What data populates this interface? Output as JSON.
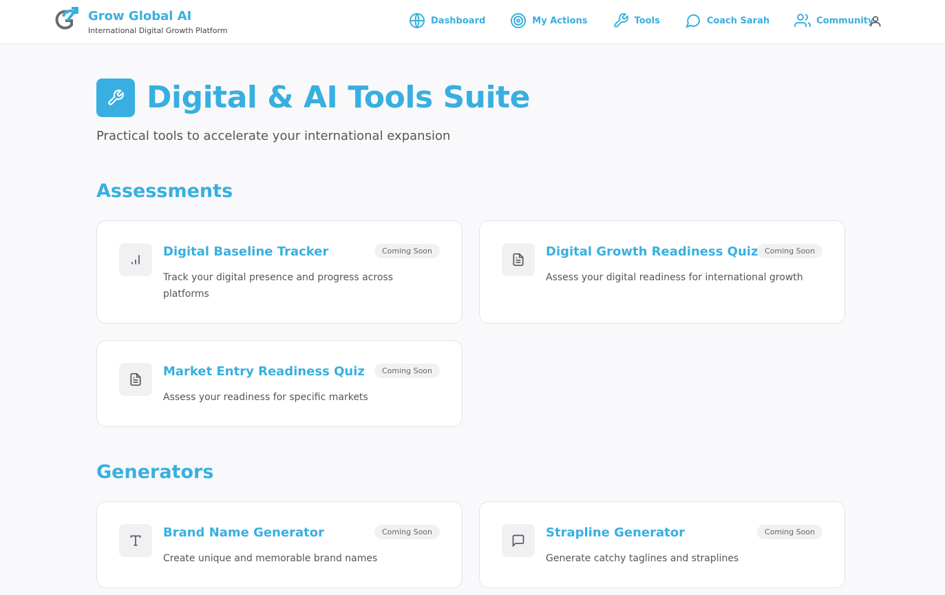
{
  "app": {
    "name": "Grow Global AI",
    "tagline": "International Digital Growth Platform"
  },
  "nav": {
    "items": [
      {
        "label": "Dashboard",
        "icon": "globe-icon"
      },
      {
        "label": "My Actions",
        "icon": "target-icon"
      },
      {
        "label": "Tools",
        "icon": "wrench-icon"
      },
      {
        "label": "Coach Sarah",
        "icon": "chat-bubble-icon"
      },
      {
        "label": "Community",
        "icon": "users-icon"
      }
    ],
    "user_icon": "user-icon"
  },
  "page": {
    "title": "Digital & AI Tools Suite",
    "subtitle": "Practical tools to accelerate your international expansion"
  },
  "sections": [
    {
      "title": "Assessments",
      "cards": [
        {
          "title": "Digital Baseline Tracker",
          "description": "Track your digital presence and progress across platforms",
          "badge": "Coming Soon",
          "icon": "bar-chart-icon"
        },
        {
          "title": "Digital Growth Readiness Quiz",
          "description": "Assess your digital readiness for international growth",
          "badge": "Coming Soon",
          "icon": "document-icon"
        },
        {
          "title": "Market Entry Readiness Quiz",
          "description": "Assess your readiness for specific markets",
          "badge": "Coming Soon",
          "icon": "document-icon"
        }
      ]
    },
    {
      "title": "Generators",
      "cards": [
        {
          "title": "Brand Name Generator",
          "description": "Create unique and memorable brand names",
          "badge": "Coming Soon",
          "icon": "type-icon"
        },
        {
          "title": "Strapline Generator",
          "description": "Generate catchy taglines and straplines",
          "badge": "Coming Soon",
          "icon": "message-square-icon"
        }
      ]
    }
  ],
  "colors": {
    "accent": "#38afe0",
    "background": "#f9f9fb",
    "card_border": "#e3e3e8"
  }
}
